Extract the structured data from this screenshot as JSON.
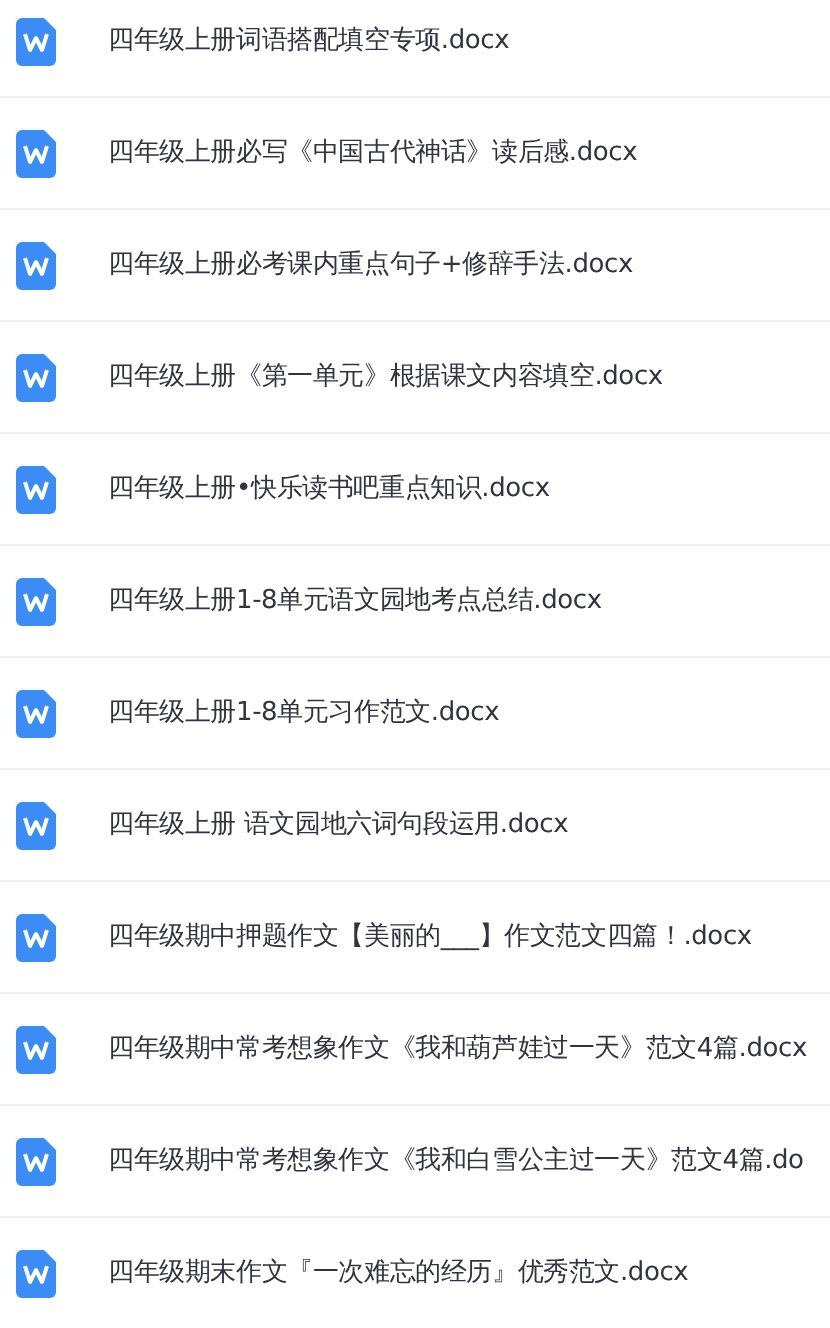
{
  "files": [
    {
      "name": "四年级上册词语搭配填空专项.docx"
    },
    {
      "name": "四年级上册必写《中国古代神话》读后感.docx"
    },
    {
      "name": "四年级上册必考课内重点句子+修辞手法.docx"
    },
    {
      "name": "四年级上册《第一单元》根据课文内容填空.docx"
    },
    {
      "name": "四年级上册•快乐读书吧重点知识.docx"
    },
    {
      "name": "四年级上册1-8单元语文园地考点总结.docx"
    },
    {
      "name": "四年级上册1-8单元习作范文.docx"
    },
    {
      "name": "四年级上册 语文园地六词句段运用.docx"
    },
    {
      "name": "四年级期中押题作文【美丽的___】作文范文四篇！.docx"
    },
    {
      "name": "四年级期中常考想象作文《我和葫芦娃过一天》范文4篇.docx"
    },
    {
      "name": "四年级期中常考想象作文《我和白雪公主过一天》范文4篇.do"
    },
    {
      "name": "四年级期末作文『一次难忘的经历』优秀范文.docx"
    }
  ]
}
